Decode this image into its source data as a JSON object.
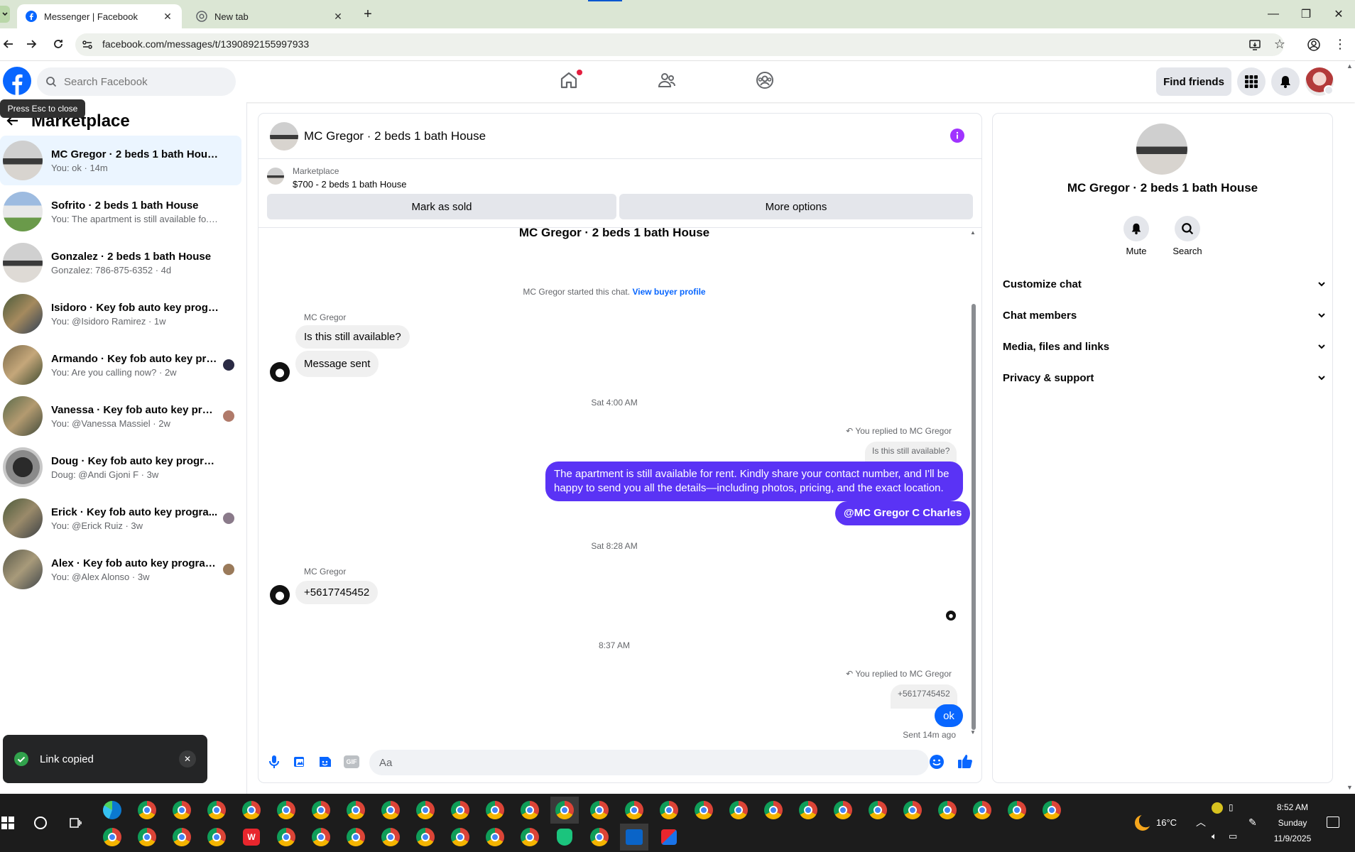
{
  "browser": {
    "tabs": [
      {
        "title": "Messenger | Facebook",
        "active": true
      },
      {
        "title": "New tab",
        "active": false
      }
    ],
    "url": "facebook.com/messages/t/1390892155997933"
  },
  "header": {
    "search_placeholder": "Search Facebook",
    "find_friends": "Find friends"
  },
  "sidebar": {
    "tooltip": "Press Esc to close",
    "title": "Marketplace",
    "conversations": [
      {
        "name": "MC Gregor · 2 beds 1 bath House",
        "preview": "You: ok · 14m",
        "selected": true
      },
      {
        "name": "Sofrito · 2 beds 1 bath House",
        "preview": "You: The apartment is still available fo... · 3d"
      },
      {
        "name": "Gonzalez · 2 beds 1 bath House",
        "preview": "Gonzalez: 786-875-6352 · 4d"
      },
      {
        "name": "Isidoro · Key fob auto key progra...",
        "preview": "You: @Isidoro Ramirez · 1w"
      },
      {
        "name": "Armando · Key fob auto key pro...",
        "preview": "You: Are you calling now? · 2w"
      },
      {
        "name": "Vanessa · Key fob auto key prog...",
        "preview": "You: @Vanessa Massiel · 2w"
      },
      {
        "name": "Doug · Key fob auto key program...",
        "preview": "Doug: @Andi Gjoni F · 3w"
      },
      {
        "name": "Erick · Key fob auto key progra...",
        "preview": "You: @Erick Ruiz · 3w"
      },
      {
        "name": "Alex · Key fob auto key program...",
        "preview": "You: @Alex Alonso · 3w"
      }
    ],
    "toast": "Link copied"
  },
  "chat": {
    "title": "MC Gregor · 2 beds 1 bath House",
    "listing_source": "Marketplace",
    "listing_title": "$700 - 2 beds 1 bath House",
    "mark_sold": "Mark as sold",
    "more_options": "More options",
    "thread_title": "MC Gregor · 2 beds 1 bath House",
    "started_text": "MC Gregor started this chat.",
    "view_buyer": "View buyer profile",
    "sender1": "MC Gregor",
    "msg_in_1": "Is this still available?",
    "msg_in_2": "Message sent",
    "ts1": "Sat 4:00 AM",
    "replied_to_1": "You replied to MC Gregor",
    "quoted_1": "Is this still available?",
    "msg_out_1": "The apartment is still available for rent. Kindly share your contact number, and I'll be happy to send you all the details—including photos, pricing, and the exact location.",
    "msg_out_2": "@MC Gregor C Charles",
    "ts2": "Sat 8:28 AM",
    "sender2": "MC Gregor",
    "msg_in_3": "+5617745452",
    "ts3": "8:37 AM",
    "replied_to_2": "You replied to MC Gregor",
    "quoted_2": "+5617745452",
    "msg_out_3": "ok",
    "sent_status": "Sent 14m ago",
    "composer_placeholder": "Aa"
  },
  "details": {
    "title": "MC Gregor · 2 beds 1 bath House",
    "mute": "Mute",
    "search": "Search",
    "sections": [
      "Customize chat",
      "Chat members",
      "Media, files and links",
      "Privacy & support"
    ]
  },
  "taskbar": {
    "weather": "16°C",
    "time": "8:52 AM",
    "day": "Sunday",
    "date": "11/9/2025"
  },
  "colors": {
    "accent": "#0866ff",
    "outgoing_bubble": "#5a33f5",
    "info_icon": "#a033ff"
  }
}
